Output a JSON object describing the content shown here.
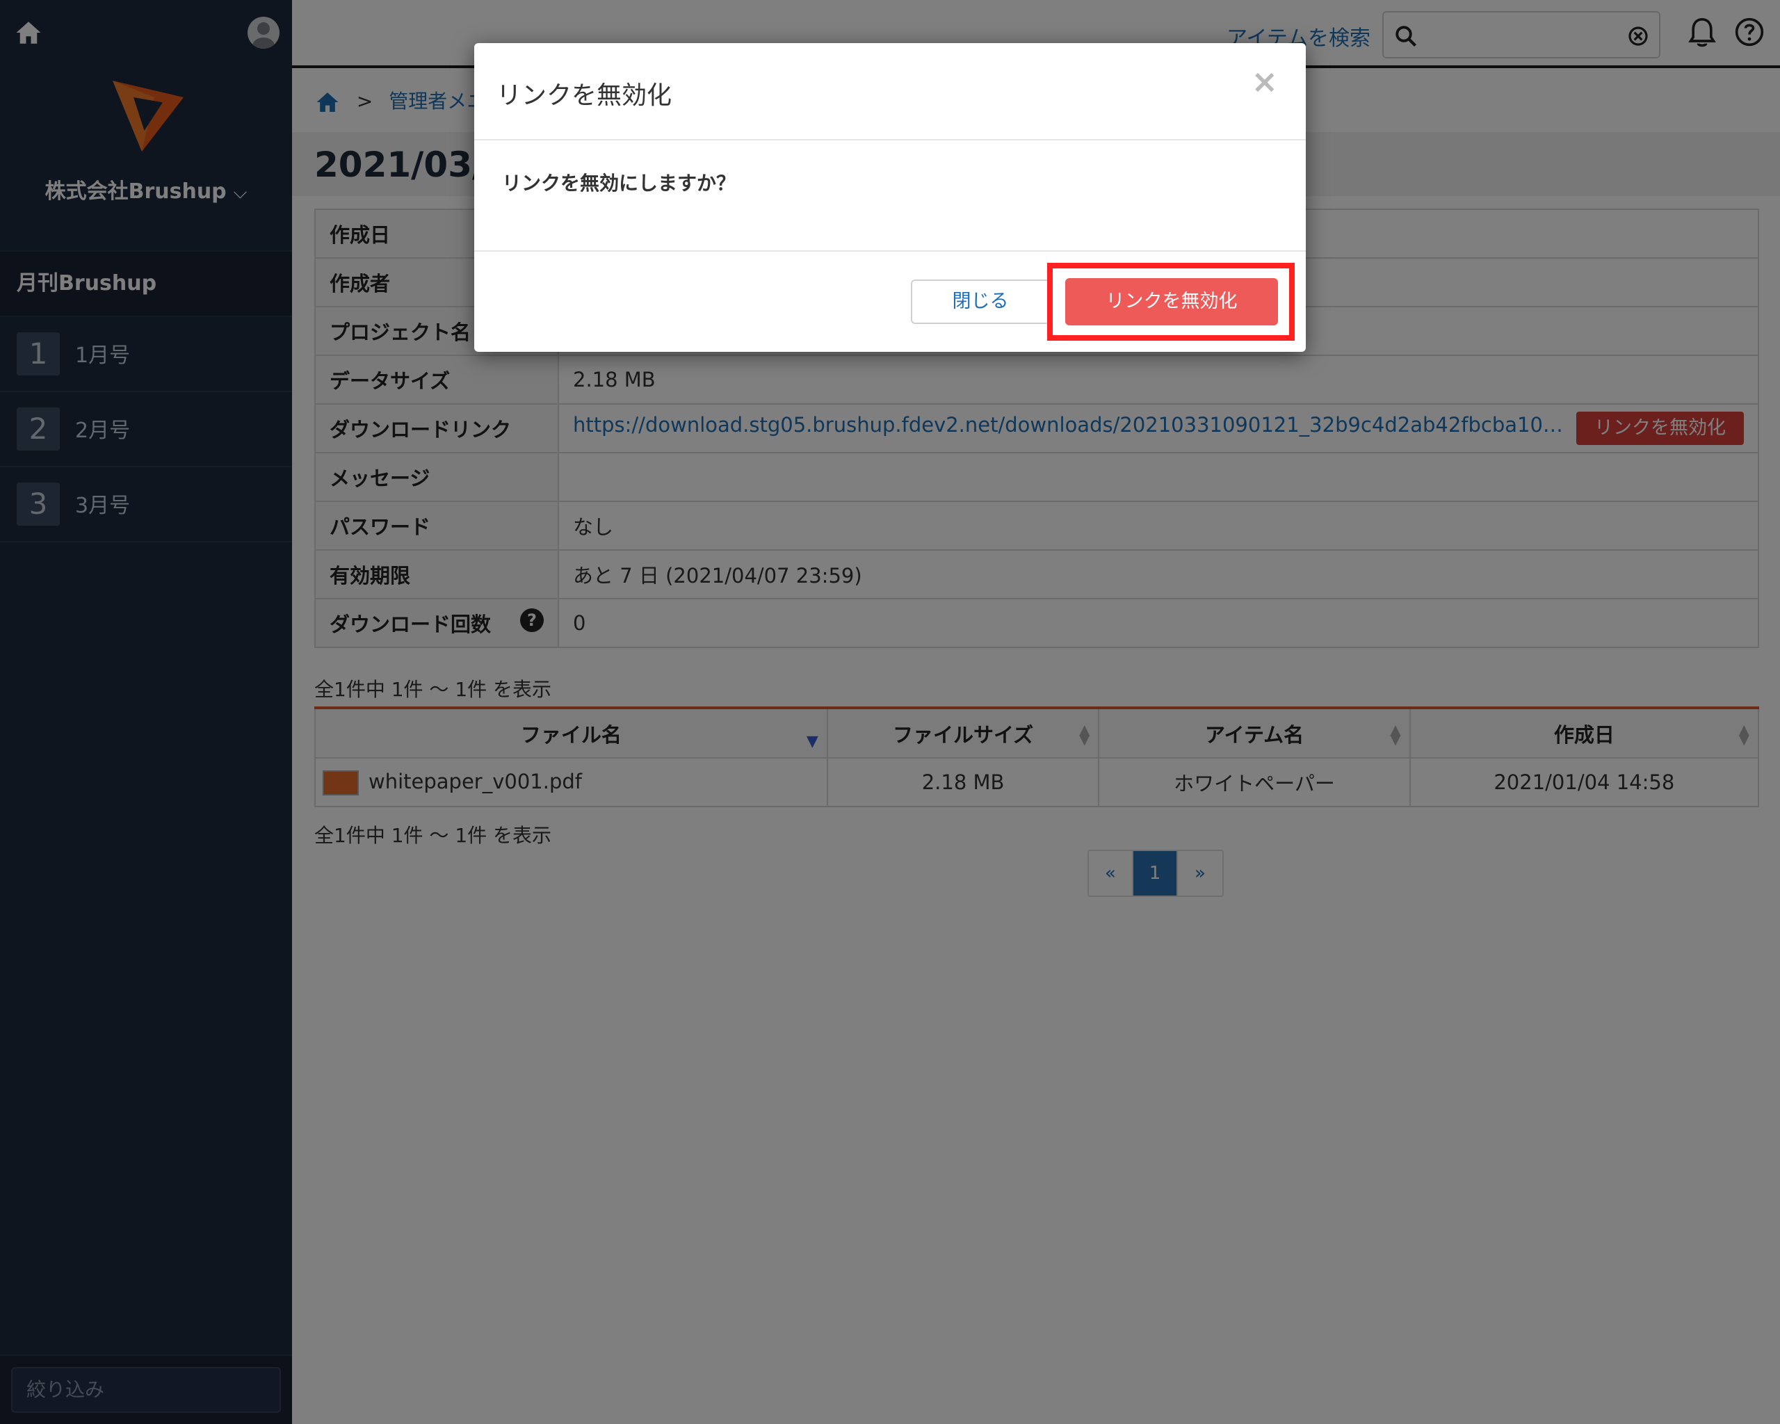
{
  "sidebar": {
    "company": "株式会社Brushup",
    "project": "月刊Brushup",
    "items": [
      {
        "num": "1",
        "label": "1月号"
      },
      {
        "num": "2",
        "label": "2月号"
      },
      {
        "num": "3",
        "label": "3月号"
      }
    ],
    "filter_placeholder": "絞り込み"
  },
  "topbar": {
    "search_link": "アイテムを検索",
    "icons": [
      "search-icon",
      "clear-icon",
      "bell-icon",
      "help-icon"
    ]
  },
  "breadcrumb": {
    "sep": ">",
    "item": "管理者メニ"
  },
  "page_title": "2021/03/",
  "details": [
    {
      "key": "作成日",
      "value": ""
    },
    {
      "key": "作成者",
      "value": ""
    },
    {
      "key": "プロジェクト名",
      "value": ""
    },
    {
      "key": "データサイズ",
      "value": "2.18 MB"
    },
    {
      "key": "ダウンロードリンク",
      "value": "https://download.stg05.brushup.fdev2.net/downloads/20210331090121_32b9c4d2ab42fbcba1047…",
      "action": "リンクを無効化"
    },
    {
      "key": "メッセージ",
      "value": ""
    },
    {
      "key": "パスワード",
      "value": "なし"
    },
    {
      "key": "有効期限",
      "value": "あと 7 日 (2021/04/07 23:59)"
    },
    {
      "key": "ダウンロード回数",
      "value": "0",
      "help": "?"
    }
  ],
  "count_text": "全1件中 1件 〜 1件 を表示",
  "file_table": {
    "headers": [
      "ファイル名",
      "ファイルサイズ",
      "アイテム名",
      "作成日"
    ],
    "rows": [
      {
        "name": "whitepaper_v001.pdf",
        "size": "2.18 MB",
        "item": "ホワイトペーパー",
        "date": "2021/01/04 14:58"
      }
    ]
  },
  "pagination": {
    "prev": "«",
    "page": "1",
    "next": "»"
  },
  "modal": {
    "title": "リンクを無効化",
    "close": "×",
    "message": "リンクを無効にしますか？",
    "close_button": "閉じる",
    "confirm_button": "リンクを無効化"
  },
  "colors": {
    "sidebar_bg": "#1f2b3f",
    "link": "#1f6eb5",
    "danger": "#ee5a58",
    "highlight": "#ff2020"
  }
}
